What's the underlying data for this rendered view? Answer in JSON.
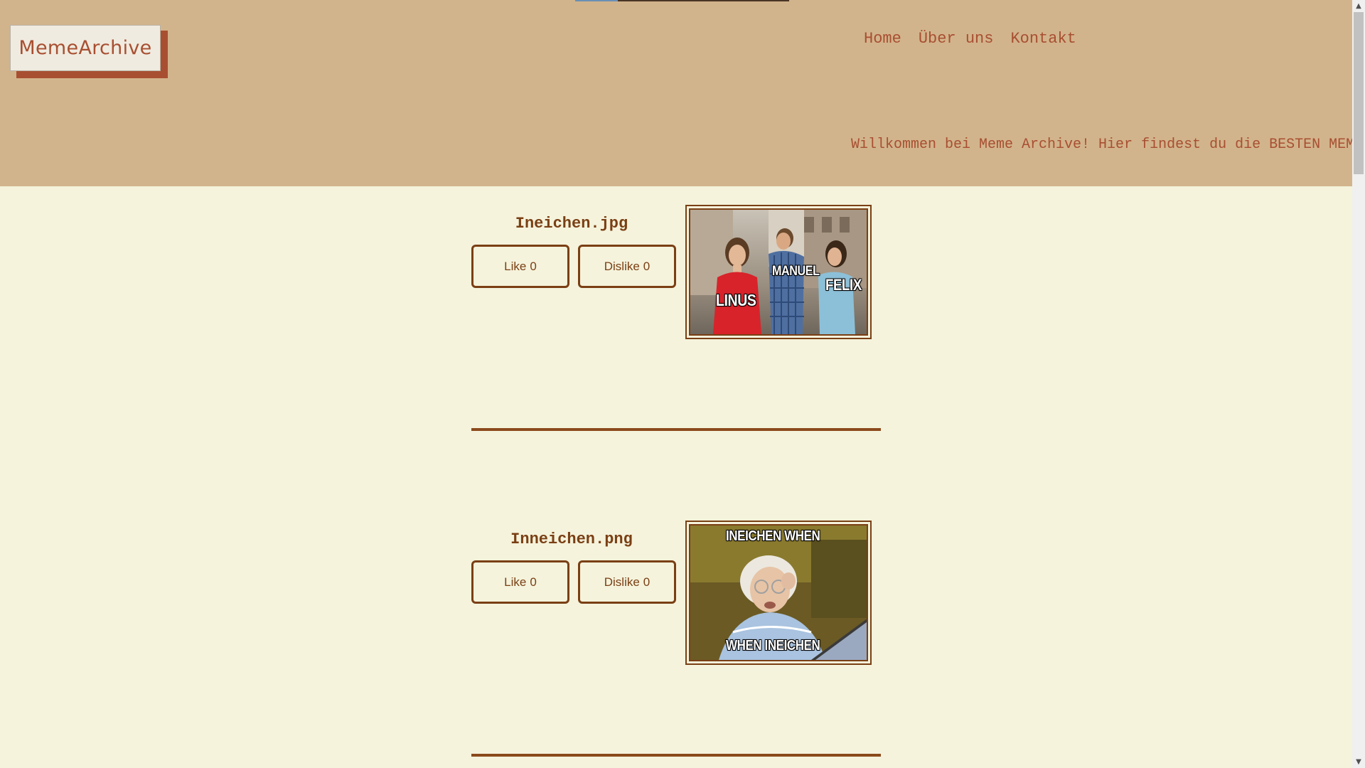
{
  "header": {
    "logo_text": "MemeArchive",
    "nav": {
      "home": "Home",
      "about": "Über uns",
      "contact": "Kontakt"
    },
    "marquee_text": "Willkommen bei Meme Archive! Hier findest du die BESTEN MEMES"
  },
  "posts": [
    {
      "title": "Ineichen.jpg",
      "like_label": "Like",
      "like_count": "0",
      "dislike_label": "Dislike",
      "dislike_count": "0",
      "image_captions": [
        "LINUS",
        "MANUEL",
        "FELIX"
      ]
    },
    {
      "title": "Inneichen.png",
      "like_label": "Like",
      "like_count": "0",
      "dislike_label": "Dislike",
      "dislike_count": "0",
      "image_captions": [
        "INEICHEN WHEN",
        "WHEN INEICHEN"
      ]
    }
  ],
  "colors": {
    "header_bg": "#d2b48c",
    "page_bg": "#f5f3dc",
    "accent": "#a84f31",
    "button_border": "#7a3f14"
  },
  "icons": {
    "scroll_up": "scroll-up-arrow-icon",
    "scroll_down": "scroll-down-arrow-icon"
  }
}
